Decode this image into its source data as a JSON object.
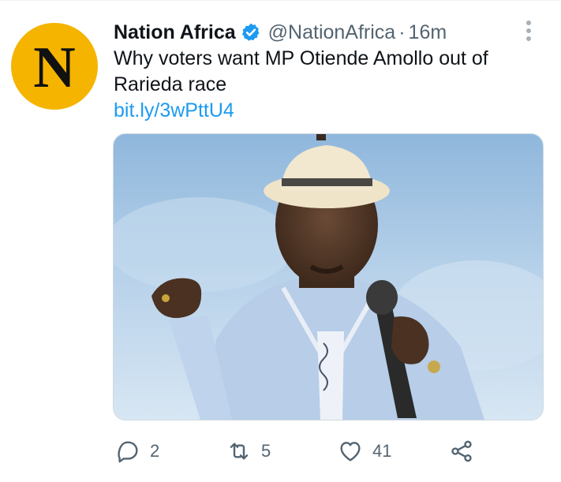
{
  "author": {
    "avatar_letter": "N",
    "name": "Nation Africa",
    "handle": "@NationAfrica",
    "separator": "·",
    "time": "16m",
    "verified_color": "#1d9bf0",
    "avatar_color": "#f5b400"
  },
  "tweet": {
    "text": "Why voters want MP Otiende Amollo out of Rarieda race",
    "link": "bit.ly/3wPttU4"
  },
  "actions": {
    "reply_count": "2",
    "retweet_count": "5",
    "like_count": "41"
  },
  "icons": [
    "verified-icon",
    "more-icon",
    "reply-icon",
    "retweet-icon",
    "like-icon",
    "share-icon"
  ]
}
